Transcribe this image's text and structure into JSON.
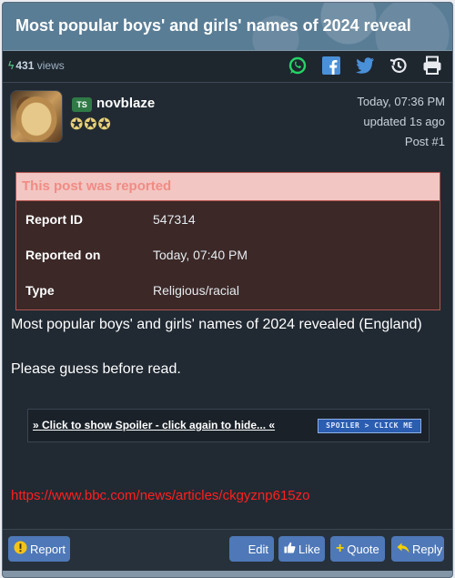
{
  "thread": {
    "title": "Most popular boys' and girls' names of 2024 reveal"
  },
  "toolbar": {
    "views_count": "431",
    "views_label": "views",
    "icons": [
      "whatsapp-icon",
      "facebook-icon",
      "twitter-icon",
      "history-icon",
      "print-icon"
    ],
    "colors": {
      "whatsapp": "#25d366",
      "facebook": "#4a90d9",
      "twitter": "#4a90d9"
    }
  },
  "post": {
    "author_tag": "TS",
    "author": "novblaze",
    "rank_stars": 3,
    "posted": "Today, 07:36 PM",
    "updated": "updated 1s ago",
    "post_number": "Post #1",
    "report": {
      "header": "This post was reported",
      "rows": [
        {
          "label": "Report ID",
          "value": "547314"
        },
        {
          "label": "Reported on",
          "value": "Today, 07:40 PM"
        },
        {
          "label": "Type",
          "value": "Religious/racial"
        }
      ]
    },
    "body_line1": "Most popular boys' and girls' names of 2024 revealed (England)",
    "body_line2": "Please guess before read.",
    "spoiler_link": "» Click to show Spoiler - click again to hide... «",
    "spoiler_badge": "SPOILER > CLICK ME",
    "url": "https://www.bbc.com/news/articles/ckgyznp615zo"
  },
  "actions": {
    "report": "Report",
    "edit": "Edit",
    "like": "Like",
    "quote": "Quote",
    "reply": "Reply"
  }
}
